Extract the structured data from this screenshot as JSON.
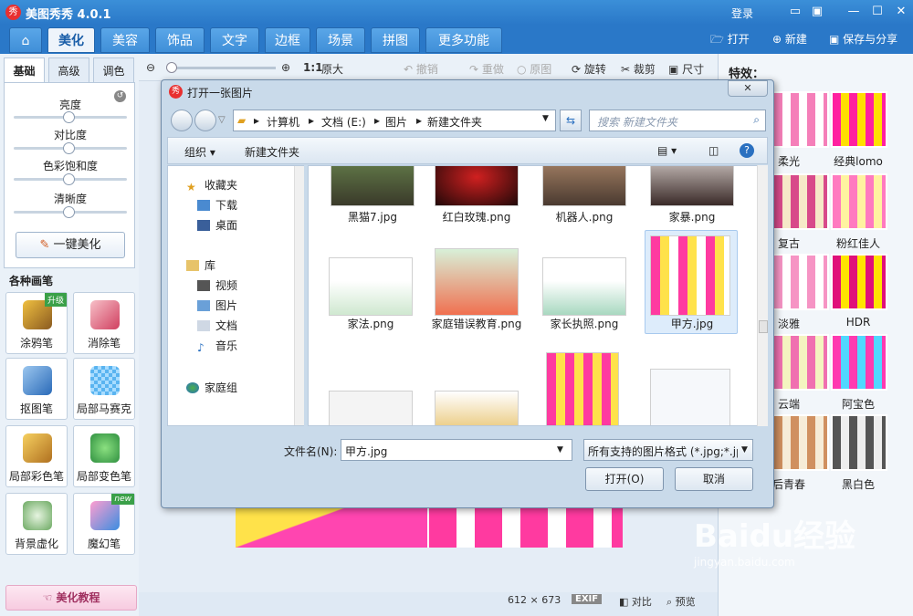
{
  "app": {
    "title": "美图秀秀 4.0.1",
    "logo": "秀",
    "login": "登录"
  },
  "nav": {
    "tabs": [
      "美化",
      "美容",
      "饰品",
      "文字",
      "边框",
      "场景",
      "拼图",
      "更多功能"
    ],
    "open": "打开",
    "new": "新建",
    "save": "保存与分享"
  },
  "toolbar": {
    "zoom_label": "1:1",
    "original_size": "原大",
    "undo": "撤销",
    "redo": "重做",
    "origin": "原图",
    "rotate": "旋转",
    "crop": "裁剪",
    "size": "尺寸"
  },
  "left": {
    "tabs": [
      "基础",
      "高级",
      "调色"
    ],
    "sliders": [
      "亮度",
      "对比度",
      "色彩饱和度",
      "清晰度"
    ],
    "onekey": "一键美化",
    "brush_header": "各种画笔",
    "brushes": [
      {
        "label": "涂鸦笔",
        "badge": "升级"
      },
      {
        "label": "消除笔",
        "badge": ""
      },
      {
        "label": "抠图笔",
        "badge": ""
      },
      {
        "label": "局部马赛克",
        "badge": ""
      },
      {
        "label": "局部彩色笔",
        "badge": ""
      },
      {
        "label": "局部变色笔",
        "badge": ""
      },
      {
        "label": "背景虚化",
        "badge": ""
      },
      {
        "label": "魔幻笔",
        "badge": "new"
      }
    ],
    "tutorial": "美化教程"
  },
  "status": {
    "dims": "612 × 673",
    "exif": "EXIF",
    "compare": "对比",
    "preview": "预览"
  },
  "right": {
    "title": "特效：",
    "effects": [
      "柔光",
      "经典lomo",
      "复古",
      "粉红佳人",
      "淡雅",
      "HDR",
      "云端",
      "阿宝色",
      "后青春",
      "黑白色"
    ]
  },
  "dialog": {
    "title": "打开一张图片",
    "close": "✕",
    "path": [
      "计算机",
      "文档 (E:)",
      "图片",
      "新建文件夹"
    ],
    "search_placeholder": "搜索 新建文件夹",
    "organize": "组织",
    "newfolder": "新建文件夹",
    "nav_groups": [
      {
        "items": [
          "收藏夹",
          "下载",
          "桌面"
        ]
      },
      {
        "items": [
          "库",
          "视频",
          "图片",
          "文档",
          "音乐"
        ]
      },
      {
        "items": [
          "家庭组"
        ]
      }
    ],
    "files": [
      "黑猫7.jpg",
      "红白玫瑰.png",
      "机器人.png",
      "家暴.png",
      "家法.png",
      "家庭错误教育.png",
      "家长执照.png",
      "甲方.jpg"
    ],
    "filename_label": "文件名(N):",
    "filename_value": "甲方.jpg",
    "filter": "所有支持的图片格式 (*.jpg;*.jp",
    "open": "打开(O)",
    "cancel": "取消"
  },
  "watermark": {
    "text": "Baidu经验",
    "url": "jingyan.baidu.com"
  }
}
